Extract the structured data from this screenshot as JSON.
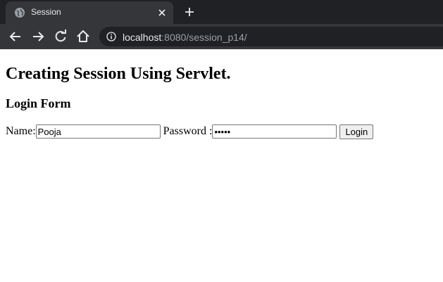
{
  "browser": {
    "tab_title": "Session",
    "url_host": "localhost",
    "url_rest": ":8080/session_p14/"
  },
  "page": {
    "heading": "Creating Session Using Servlet.",
    "subheading": "Login Form"
  },
  "form": {
    "name_label": "Name:",
    "name_value": "Pooja",
    "password_label": "Password :",
    "password_value": "•••••",
    "login_label": "Login"
  }
}
